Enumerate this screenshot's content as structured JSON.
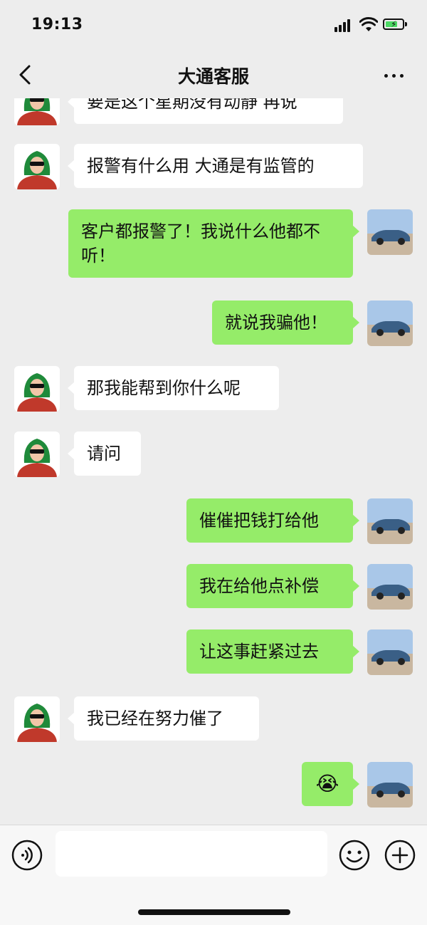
{
  "status": {
    "time": "19:13"
  },
  "nav": {
    "title": "大通客服"
  },
  "messages": [
    {
      "side": "in",
      "text": "要是这个星期没有动静 再说"
    },
    {
      "side": "in",
      "text": "报警有什么用 大通是有监管的"
    },
    {
      "side": "out",
      "text": "客户都报警了！我说什么他都不听！"
    },
    {
      "side": "out",
      "text": "就说我骗他！"
    },
    {
      "side": "in",
      "text": "那我能帮到你什么呢"
    },
    {
      "side": "in",
      "text": "请问"
    },
    {
      "side": "out",
      "text": "催催把钱打给他"
    },
    {
      "side": "out",
      "text": "我在给他点补偿"
    },
    {
      "side": "out",
      "text": "让这事赶紧过去"
    },
    {
      "side": "in",
      "text": "我已经在努力催了"
    },
    {
      "side": "out",
      "text": "😭"
    }
  ],
  "input": {
    "value": "",
    "placeholder": ""
  },
  "colors": {
    "background": "#ededed",
    "sent_bubble": "#95ec69",
    "received_bubble": "#ffffff"
  }
}
